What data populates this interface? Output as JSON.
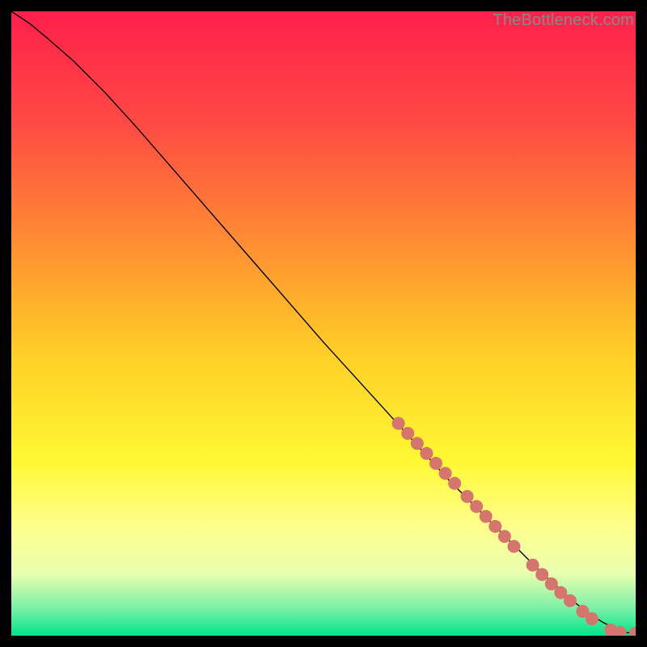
{
  "watermark": "TheBottleneck.com",
  "chart_data": {
    "type": "line",
    "title": "",
    "xlabel": "",
    "ylabel": "",
    "xlim": [
      0,
      100
    ],
    "ylim": [
      0,
      100
    ],
    "grid": false,
    "legend": false,
    "background_gradient": {
      "stops": [
        {
          "offset": 0.0,
          "color": "#ff1f4b"
        },
        {
          "offset": 0.18,
          "color": "#ff4a43"
        },
        {
          "offset": 0.36,
          "color": "#ff8a33"
        },
        {
          "offset": 0.55,
          "color": "#ffcf26"
        },
        {
          "offset": 0.72,
          "color": "#fff833"
        },
        {
          "offset": 0.82,
          "color": "#ffff8a"
        },
        {
          "offset": 0.9,
          "color": "#eaffb0"
        },
        {
          "offset": 0.955,
          "color": "#7df0a6"
        },
        {
          "offset": 1.0,
          "color": "#00e58a"
        }
      ]
    },
    "series": [
      {
        "name": "curve",
        "color": "#000000",
        "stroke_width": 1.4,
        "x": [
          0,
          3,
          6,
          10,
          15,
          20,
          30,
          40,
          50,
          60,
          70,
          78,
          85,
          90,
          93,
          95,
          97,
          98.5,
          100
        ],
        "y": [
          100,
          98,
          95.5,
          92,
          87,
          81.5,
          70,
          58.5,
          47,
          36,
          25,
          17,
          10,
          5.5,
          3.2,
          2.0,
          1.0,
          0.5,
          0.4
        ]
      }
    ],
    "markers": {
      "color": "#d6746e",
      "radius": 8,
      "points": [
        {
          "x": 62.0,
          "y": 34.0
        },
        {
          "x": 63.5,
          "y": 32.4
        },
        {
          "x": 65.0,
          "y": 30.8
        },
        {
          "x": 66.5,
          "y": 29.2
        },
        {
          "x": 68.0,
          "y": 27.6
        },
        {
          "x": 69.5,
          "y": 26.0
        },
        {
          "x": 71.0,
          "y": 24.4
        },
        {
          "x": 73.0,
          "y": 22.3
        },
        {
          "x": 74.5,
          "y": 20.7
        },
        {
          "x": 76.0,
          "y": 19.1
        },
        {
          "x": 77.5,
          "y": 17.5
        },
        {
          "x": 79.0,
          "y": 15.9
        },
        {
          "x": 80.5,
          "y": 14.3
        },
        {
          "x": 83.5,
          "y": 11.3
        },
        {
          "x": 85.0,
          "y": 9.8
        },
        {
          "x": 86.5,
          "y": 8.3
        },
        {
          "x": 88.0,
          "y": 6.9
        },
        {
          "x": 89.5,
          "y": 5.6
        },
        {
          "x": 91.5,
          "y": 3.9
        },
        {
          "x": 93.0,
          "y": 2.7
        },
        {
          "x": 96.0,
          "y": 0.9
        },
        {
          "x": 97.5,
          "y": 0.5
        },
        {
          "x": 100.0,
          "y": 0.4
        }
      ]
    }
  }
}
